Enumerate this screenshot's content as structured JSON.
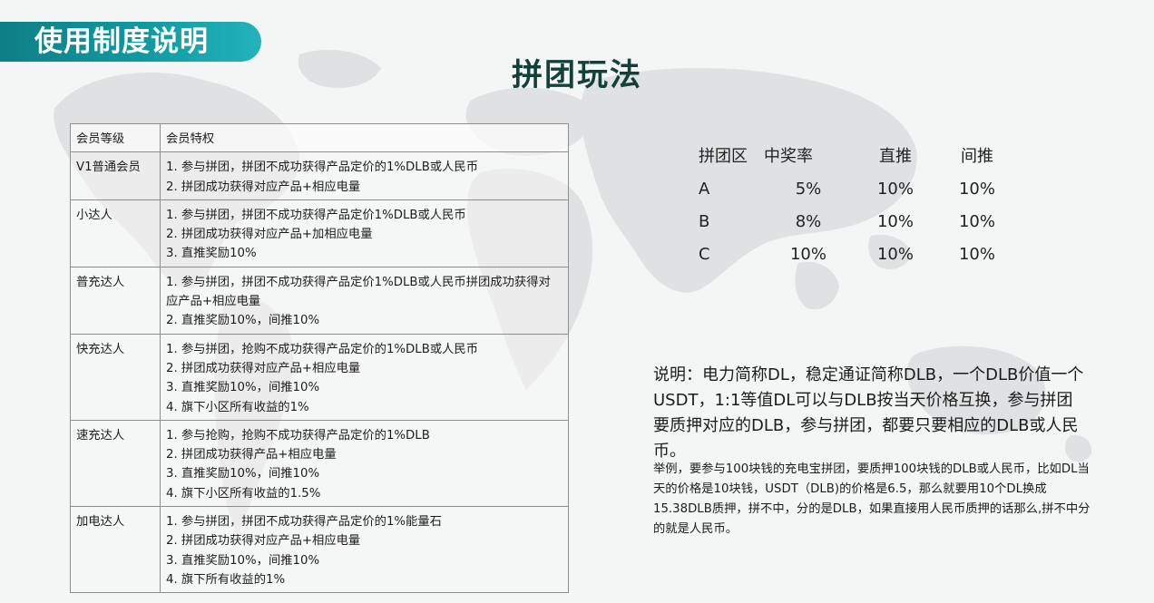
{
  "banner": {
    "title": "使用制度说明"
  },
  "main_title": "拼团玩法",
  "rules_table": {
    "headers": [
      "会员等级",
      "会员特权"
    ],
    "rows": [
      {
        "level": "V1普通会员",
        "perks": [
          "1. 参与拼团，拼团不成功获得产品定价的1%DLB或人民币",
          "2. 拼团成功获得对应产品+相应电量"
        ]
      },
      {
        "level": "小达人",
        "perks": [
          "1. 参与拼团，拼团不成功获得产品定价1%DLB或人民币",
          "2. 拼团成功获得对应产品+加相应电量",
          "3. 直推奖励10%"
        ]
      },
      {
        "level": "普充达人",
        "perks": [
          "1. 参与拼团，拼团不成功获得产品定价1%DLB或人民币拼团成功获得对应产品+相应电量",
          "2. 直推奖励10%，间推10%"
        ]
      },
      {
        "level": "快充达人",
        "perks": [
          "1. 参与拼团，抢购不成功获得产品定价的1%DLB或人民币",
          "2. 拼团成功获得对应产品+相应电量",
          "3. 直推奖励10%，间推10%",
          "4. 旗下小区所有收益的1%"
        ]
      },
      {
        "level": "速充达人",
        "perks": [
          "1. 参与抢购，抢购不成功获得产品定价的1%DLB",
          "2. 拼团成功获得产品+相应电量",
          "3. 直推奖励10%，间推10%",
          "4. 旗下小区所有收益的1.5%"
        ]
      },
      {
        "level": "加电达人",
        "perks": [
          "1. 参与拼团，拼团不成功获得产品定价的1%能量石",
          "2. 拼团成功获得对应产品+相应电量",
          "3. 直推奖励10%，间推10%",
          "4. 旗下所有收益的1%"
        ]
      }
    ]
  },
  "rate_table": {
    "headers": [
      "拼团区",
      "中奖率",
      "直推",
      "间推"
    ],
    "rows": [
      {
        "zone": "A",
        "win_rate": "5%",
        "direct": "10%",
        "indirect": "10%"
      },
      {
        "zone": "B",
        "win_rate": "8%",
        "direct": "10%",
        "indirect": "10%"
      },
      {
        "zone": "C",
        "win_rate": "10%",
        "direct": "10%",
        "indirect": "10%"
      }
    ]
  },
  "explanation": "说明：电力简称DL，稳定通证简称DLB，一个DLB价值一个USDT，1:1等值DL可以与DLB按当天价格互换，参与拼团要质押对应的DLB，参与拼团，都要只要相应的DLB或人民币。",
  "example": "举例，要参与100块钱的充电宝拼团，要质押100块钱的DLB或人民币，比如DL当天的价格是10块钱，USDT（DLB)的价格是6.5，那么就要用10个DL换成15.38DLB质押，拼不中，分的是DLB，如果直接用人民币质押的话那么,拼不中分的就是人民币。",
  "colors": {
    "banner": "#0f9aa0",
    "title": "#14403a",
    "map": "#dcdedf"
  }
}
